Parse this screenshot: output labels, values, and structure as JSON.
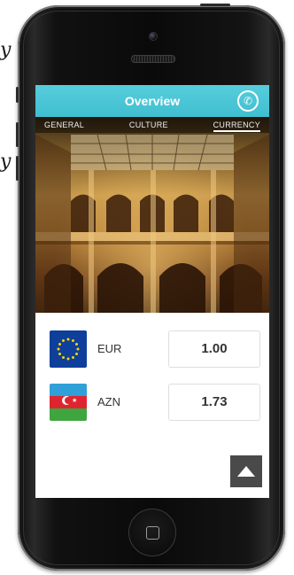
{
  "app": {
    "title": "Overview"
  },
  "tabs": [
    {
      "label": "GENERAL"
    },
    {
      "label": "CULTURE"
    },
    {
      "label": "CURRENCY",
      "active": true
    }
  ],
  "currency": {
    "rows": [
      {
        "code": "EUR",
        "amount": "1.00",
        "flag": "eu-flag"
      },
      {
        "code": "AZN",
        "amount": "1.73",
        "flag": "azerbaijan-flag"
      }
    ]
  },
  "stray_glyphs": [
    "y",
    "y"
  ],
  "colors": {
    "header": "#4fc7d6",
    "eu_blue": "#0e3f9a",
    "eu_star": "#ffd200",
    "az_blue": "#2fa0d8",
    "az_red": "#e0242f",
    "az_green": "#3fa53f",
    "scroll_button": "#4a4a4a"
  },
  "icons": {
    "call": "phone-icon",
    "scroll_top": "triangle-up-icon",
    "home": "home-square-icon"
  }
}
